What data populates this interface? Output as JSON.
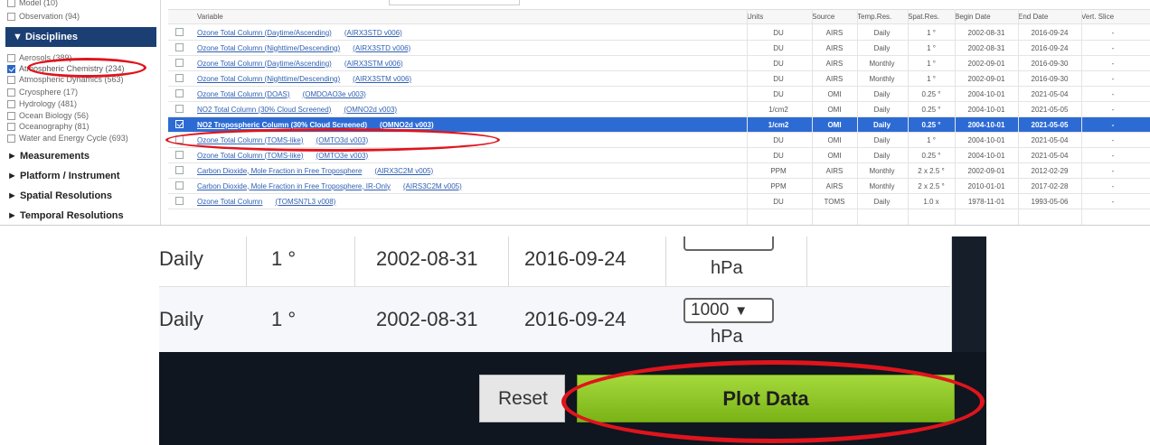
{
  "sidebar": {
    "top_items": [
      {
        "label": "Model (10)",
        "checked": false
      },
      {
        "label": "Observation (94)",
        "checked": false
      }
    ],
    "disciplines_header": "▼ Disciplines",
    "disciplines": [
      {
        "label": "Aerosols (389)",
        "checked": false
      },
      {
        "label": "Atmospheric Chemistry (234)",
        "checked": true
      },
      {
        "label": "Atmospheric Dynamics (563)",
        "checked": false
      },
      {
        "label": "Cryosphere (17)",
        "checked": false
      },
      {
        "label": "Hydrology (481)",
        "checked": false
      },
      {
        "label": "Ocean Biology (56)",
        "checked": false
      },
      {
        "label": "Oceanography (81)",
        "checked": false
      },
      {
        "label": "Water and Energy Cycle (693)",
        "checked": false
      }
    ],
    "sections": [
      "► Measurements",
      "► Platform / Instrument",
      "► Spatial Resolutions",
      "► Temporal Resolutions"
    ]
  },
  "table": {
    "headers": [
      "Variable",
      "Units",
      "Source",
      "Temp.Res.",
      "Spat.Res.",
      "Begin Date",
      "End Date",
      "Vert. Slice"
    ],
    "rows": [
      {
        "var": "Ozone Total Column (Daytime/Ascending)",
        "code": "(AIRX3STD v006)",
        "units": "DU",
        "source": "AIRS",
        "temp": "Daily",
        "spat": "1 °",
        "begin": "2002-08-31",
        "end": "2016-09-24",
        "vert": "-",
        "selected": false
      },
      {
        "var": "Ozone Total Column (Nighttime/Descending)",
        "code": "(AIRX3STD v006)",
        "units": "DU",
        "source": "AIRS",
        "temp": "Daily",
        "spat": "1 °",
        "begin": "2002-08-31",
        "end": "2016-09-24",
        "vert": "-",
        "selected": false
      },
      {
        "var": "Ozone Total Column (Daytime/Ascending)",
        "code": "(AIRX3STM v006)",
        "units": "DU",
        "source": "AIRS",
        "temp": "Monthly",
        "spat": "1 °",
        "begin": "2002-09-01",
        "end": "2016-09-30",
        "vert": "-",
        "selected": false
      },
      {
        "var": "Ozone Total Column (Nighttime/Descending)",
        "code": "(AIRX3STM v006)",
        "units": "DU",
        "source": "AIRS",
        "temp": "Monthly",
        "spat": "1 °",
        "begin": "2002-09-01",
        "end": "2016-09-30",
        "vert": "-",
        "selected": false
      },
      {
        "var": "Ozone Total Column (DOAS)",
        "code": "(OMDOAO3e v003)",
        "units": "DU",
        "source": "OMI",
        "temp": "Daily",
        "spat": "0.25 °",
        "begin": "2004-10-01",
        "end": "2021-05-04",
        "vert": "-",
        "selected": false
      },
      {
        "var": "NO2 Total Column (30% Cloud Screened)",
        "code": "(OMNO2d v003)",
        "units": "1/cm2",
        "source": "OMI",
        "temp": "Daily",
        "spat": "0.25 °",
        "begin": "2004-10-01",
        "end": "2021-05-05",
        "vert": "-",
        "selected": false
      },
      {
        "var": "NO2 Tropospheric Column (30% Cloud Screened)",
        "code": "(OMNO2d v003)",
        "units": "1/cm2",
        "source": "OMI",
        "temp": "Daily",
        "spat": "0.25 °",
        "begin": "2004-10-01",
        "end": "2021-05-05",
        "vert": "-",
        "selected": true
      },
      {
        "var": "Ozone Total Column (TOMS-like)",
        "code": "(OMTO3d v003)",
        "units": "DU",
        "source": "OMI",
        "temp": "Daily",
        "spat": "1 °",
        "begin": "2004-10-01",
        "end": "2021-05-04",
        "vert": "-",
        "selected": false
      },
      {
        "var": "Ozone Total Column (TOMS-like)",
        "code": "(OMTO3e v003)",
        "units": "DU",
        "source": "OMI",
        "temp": "Daily",
        "spat": "0.25 °",
        "begin": "2004-10-01",
        "end": "2021-05-04",
        "vert": "-",
        "selected": false
      },
      {
        "var": "Carbon Dioxide, Mole Fraction in Free Troposphere",
        "code": "(AIRX3C2M v005)",
        "units": "PPM",
        "source": "AIRS",
        "temp": "Monthly",
        "spat": "2 x 2.5 °",
        "begin": "2002-09-01",
        "end": "2012-02-29",
        "vert": "-",
        "selected": false
      },
      {
        "var": "Carbon Dioxide, Mole Fraction in Free Troposphere, IR-Only",
        "code": "(AIRS3C2M v005)",
        "units": "PPM",
        "source": "AIRS",
        "temp": "Monthly",
        "spat": "2 x 2.5 °",
        "begin": "2010-01-01",
        "end": "2017-02-28",
        "vert": "-",
        "selected": false
      },
      {
        "var": "Ozone Total Column",
        "code": "(TOMSN7L3 v008)",
        "units": "DU",
        "source": "TOMS",
        "temp": "Daily",
        "spat": "1.0 x",
        "begin": "1978-11-01",
        "end": "1993-05-06",
        "vert": "-",
        "selected": false
      }
    ]
  },
  "zoom": {
    "row1": {
      "temp": "Daily",
      "spat": "1 °",
      "begin": "2002-08-31",
      "end": "2016-09-24",
      "unit": "hPa"
    },
    "row2": {
      "temp": "Daily",
      "spat": "1 °",
      "begin": "2002-08-31",
      "end": "2016-09-24",
      "select_value": "1000",
      "unit": "hPa"
    },
    "reset_label": "Reset",
    "plot_label": "Plot Data"
  },
  "colors": {
    "selected_row": "#2d6bd4",
    "sidebar_header": "#1b3f73",
    "annotation": "#e0141c",
    "plot_button": "#8cc52a"
  }
}
